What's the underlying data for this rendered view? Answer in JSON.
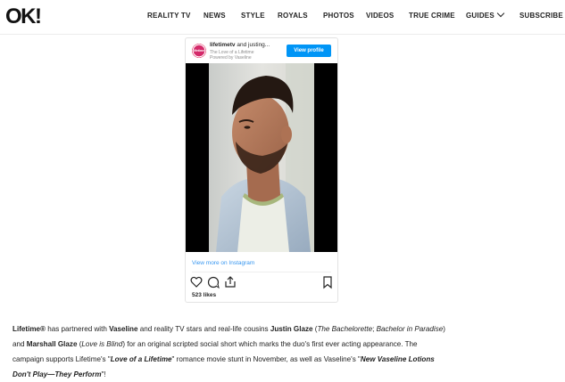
{
  "header": {
    "logo": "OK!",
    "nav": [
      "REALITY TV",
      "NEWS",
      "STYLE",
      "ROYALS",
      "PHOTOS",
      "VIDEOS",
      "TRUE CRIME",
      "GUIDES",
      "SUBSCRIBE"
    ]
  },
  "instagram": {
    "username": "lifetimetv",
    "username_suffix": "and justing...",
    "subtitle_line1": "The Love of a Lifetime",
    "subtitle_line2": "Powered by Vaseline",
    "avatar_text": "lifetime",
    "view_profile": "View profile",
    "view_more": "View more on Instagram",
    "likes": "523 likes"
  },
  "article": {
    "s1": "Lifetime®",
    "s2": " has partnered with ",
    "s3": "Vaseline",
    "s4": " and reality TV stars and real-life cousins ",
    "s5": "Justin Glaze",
    "s6": " (",
    "s7": "The Bachelorette",
    "s8": "; ",
    "s9": "Bachelor in Paradise",
    "s10": ")",
    "s11": "and ",
    "s12": "Marshall Glaze",
    "s13": " (",
    "s14": "Love is Blind",
    "s15": ") for an original scripted social short which marks the duo's first ever acting appearance. The",
    "s16": "campaign supports Lifetime's \"",
    "s17": "Love of a Lifetime",
    "s18": "\" romance movie stunt in November, as well as Vaseline's \"",
    "s19": "New Vaseline Lotions",
    "s20": "Don't Play—They Perform",
    "s21": "\"!"
  },
  "colors": {
    "accent_blue": "#0095f6",
    "link_blue": "#3897f0",
    "text": "#222222"
  }
}
